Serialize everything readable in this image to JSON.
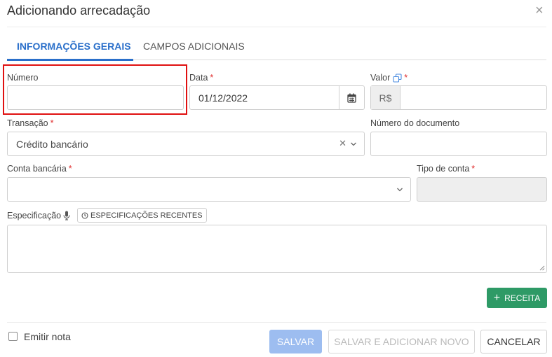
{
  "dialog": {
    "title": "Adicionando arrecadação",
    "close_symbol": "×"
  },
  "tabs": [
    {
      "label": "INFORMAÇÕES GERAIS",
      "active": true
    },
    {
      "label": "CAMPOS ADICIONAIS",
      "active": false
    }
  ],
  "form": {
    "numero": {
      "label": "Número",
      "value": "",
      "required": false
    },
    "data": {
      "label": "Data",
      "value": "01/12/2022",
      "required": true,
      "icon": "calendar-icon"
    },
    "valor": {
      "label": "Valor",
      "currency": "R$",
      "value": "",
      "required": true,
      "icon": "copy-icon"
    },
    "transacao": {
      "label": "Transação",
      "value": "Crédito bancário",
      "required": true
    },
    "numero_documento": {
      "label": "Número do documento",
      "value": ""
    },
    "conta_bancaria": {
      "label": "Conta bancária",
      "value": "",
      "required": true
    },
    "tipo_conta": {
      "label": "Tipo de conta",
      "value": "",
      "required": true
    },
    "especificacao": {
      "label": "Especificação",
      "recent_label": "ESPECIFICAÇÕES RECENTES",
      "value": "",
      "icon": "microphone-icon"
    }
  },
  "required_mark": "*",
  "receita_button": {
    "label": "RECEITA",
    "icon": "plus-icon"
  },
  "footer": {
    "emitir_nota": {
      "label": "Emitir nota",
      "checked": false
    },
    "salvar": "SALVAR",
    "salvar_novo": "SALVAR E ADICIONAR NOVO",
    "cancelar": "CANCELAR"
  },
  "colors": {
    "accent": "#2a6fca",
    "required": "#e02d2d",
    "success": "#2e9a66",
    "highlight": "#e01010",
    "primary_disabled": "#9dbdf0"
  }
}
